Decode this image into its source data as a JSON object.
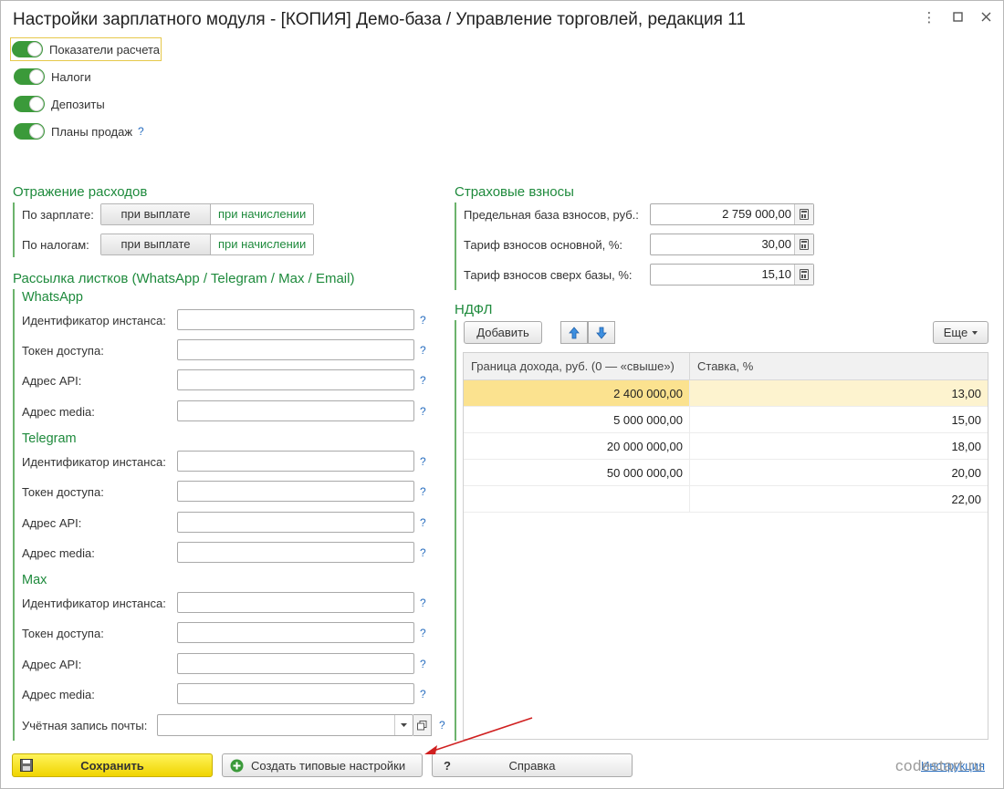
{
  "window": {
    "title": "Настройки зарплатного модуля - [КОПИЯ] Демо-база / Управление торговлей, редакция 11",
    "controls": {
      "more": "⋮",
      "maximize": "☐",
      "close": "✕"
    }
  },
  "toggles": [
    {
      "label": "Показатели расчета",
      "on": true
    },
    {
      "label": "Налоги",
      "on": true
    },
    {
      "label": "Депозиты",
      "on": true
    },
    {
      "label": "Планы продаж",
      "on": true,
      "help": "?"
    }
  ],
  "expenses": {
    "title": "Отражение расходов",
    "rows": [
      {
        "label": "По зарплате:",
        "opt_a": "при выплате",
        "opt_b": "при начислении"
      },
      {
        "label": "По налогам:",
        "opt_a": "при выплате",
        "opt_b": "при начислении"
      }
    ]
  },
  "mailing": {
    "title": "Рассылка листков (WhatsApp / Telegram / Max / Email)",
    "groups": [
      {
        "name": "WhatsApp",
        "fields": [
          "Идентификатор инстанса:",
          "Токен доступа:",
          "Адрес API:",
          "Адрес media:"
        ]
      },
      {
        "name": "Telegram",
        "fields": [
          "Идентификатор инстанса:",
          "Токен доступа:",
          "Адрес API:",
          "Адрес media:"
        ]
      },
      {
        "name": "Max",
        "fields": [
          "Идентификатор инстанса:",
          "Токен доступа:",
          "Адрес API:",
          "Адрес media:"
        ]
      }
    ],
    "help": "?",
    "email_label": "Учётная запись почты:"
  },
  "insurance": {
    "title": "Страховые взносы",
    "rows": [
      {
        "label": "Предельная база взносов, руб.:",
        "value": "2 759 000,00"
      },
      {
        "label": "Тариф взносов основной, %:",
        "value": "30,00"
      },
      {
        "label": "Тариф взносов сверх базы, %:",
        "value": "15,10"
      }
    ]
  },
  "ndfl": {
    "title": "НДФЛ",
    "add_label": "Добавить",
    "more_label": "Еще",
    "columns": [
      "Граница дохода, руб. (0 — «свыше»)",
      "Ставка, %"
    ],
    "rows": [
      {
        "limit": "2 400 000,00",
        "rate": "13,00"
      },
      {
        "limit": "5 000 000,00",
        "rate": "15,00"
      },
      {
        "limit": "20 000 000,00",
        "rate": "18,00"
      },
      {
        "limit": "50 000 000,00",
        "rate": "20,00"
      },
      {
        "limit": "",
        "rate": "22,00"
      }
    ]
  },
  "footer": {
    "save": "Сохранить",
    "create_defaults": "Создать типовые настройки",
    "help_icon": "?",
    "help": "Справка",
    "instruction": "Инструкция",
    "watermark": "codestart.ru"
  },
  "colors": {
    "accent_green": "#1e8a3c",
    "toggle_on": "#3b9a3a",
    "save_yellow": "#f5dc10",
    "selected_row": "#fbe28f",
    "link_blue": "#2a6fc0",
    "annotation_arrow": "#d02020"
  }
}
